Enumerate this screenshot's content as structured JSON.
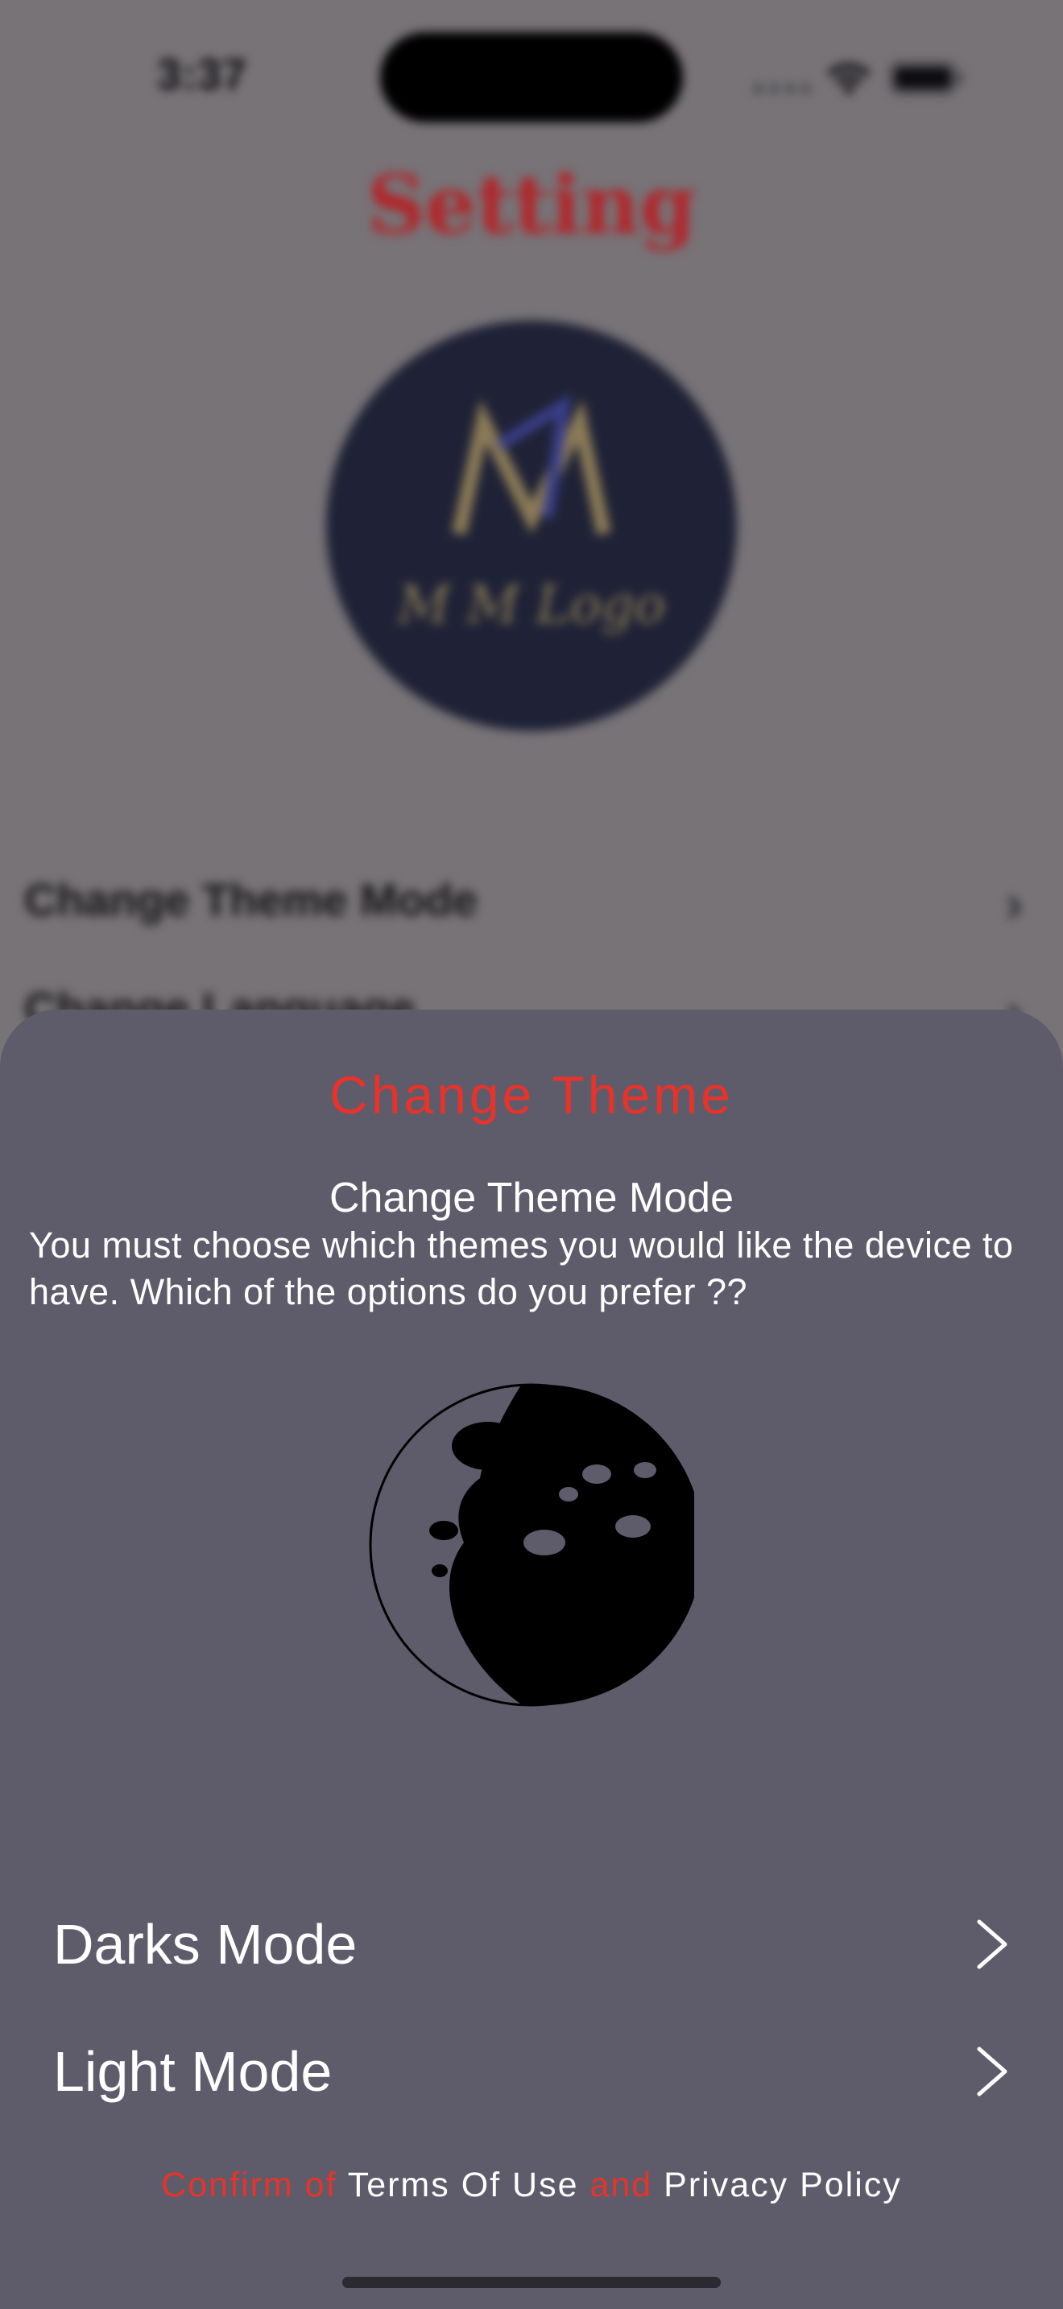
{
  "status_bar": {
    "time": "3:37"
  },
  "background": {
    "title": "Setting",
    "logo_text": "M M Logo",
    "rows": [
      {
        "label": "Change Theme Mode"
      },
      {
        "label": "Change Language"
      },
      {
        "label": ""
      },
      {
        "label": ""
      }
    ]
  },
  "sheet": {
    "title": "Change Theme",
    "subtitle": "Change Theme Mode",
    "description": "You must choose which themes you would like the device to have. Which of the options do you prefer ??",
    "options": [
      {
        "label": "Darks Mode"
      },
      {
        "label": "Light Mode"
      }
    ],
    "terms": {
      "prefix": "Confirm of",
      "terms_link": "Terms Of Use",
      "conjunction": "and",
      "privacy_link": "Privacy Policy"
    }
  },
  "colors": {
    "accent": "#e8322a",
    "sheet_bg": "#5e5c6a",
    "overlay_bg": "#777377"
  },
  "icons": {
    "moon": "crescent-moon-icon",
    "chevron": "chevron-right-icon"
  }
}
